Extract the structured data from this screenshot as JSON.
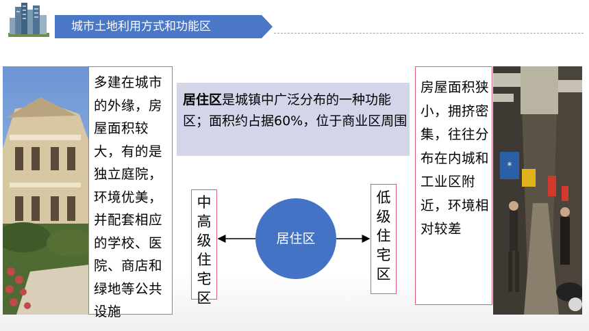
{
  "header": {
    "title": "城市土地利用方式和功能区"
  },
  "left_box": {
    "text": "多建在城市的外缘，房屋面积较大，有的是独立庭院，环境优美，并配套相应的学校、医院、商店和绿地等公共设施"
  },
  "info_box": {
    "bold": "居住区",
    "text": "是城镇中广泛分布的一种功能区；面积约占据60%，位于商业区周围"
  },
  "center": {
    "label": "居住区"
  },
  "mid_tag": {
    "chars": [
      "中",
      "高",
      "级",
      "住",
      "宅",
      "区"
    ]
  },
  "low_tag": {
    "chars": [
      "低",
      "级",
      "住",
      "宅",
      "区"
    ]
  },
  "right_box": {
    "text": "房屋面积狭小，拥挤密集，往往分布在内城和工业区附近，环境相对较差"
  },
  "icons": [
    "city-buildings-logo",
    "villa-photo",
    "old-street-photo"
  ],
  "colors": {
    "accent_blue": "#4472c4",
    "box_border": "#e05a75",
    "info_bg": "#d3d5e9"
  }
}
